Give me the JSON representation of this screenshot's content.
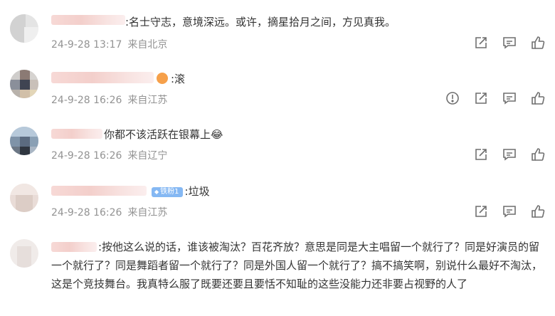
{
  "comments": [
    {
      "text": ":名士守志，意境深远。或许，摘星拾月之间，方见真我。",
      "date": "24-9-28 13:17",
      "location": "来自北京",
      "actions": [
        "share-icon",
        "comment-icon",
        "like-icon"
      ]
    },
    {
      "text": ":滚",
      "date": "24-9-28 16:26",
      "location": "来自江苏",
      "actions": [
        "report-icon",
        "share-icon",
        "comment-icon",
        "like-icon"
      ]
    },
    {
      "text": "你都不该活跃在银幕上",
      "emoji": "😂",
      "date": "24-9-28 16:26",
      "location": "来自辽宁",
      "actions": [
        "share-icon",
        "comment-icon",
        "like-icon"
      ]
    },
    {
      "badge": "铁粉1",
      "text": ":垃圾",
      "date": "24-9-28 16:26",
      "location": "来自江苏",
      "actions": [
        "share-icon",
        "comment-icon",
        "like-icon"
      ]
    },
    {
      "text": ":按他这么说的话，谁该被淘汰？百花齐放？意思是同是大主唱留一个就行了？同是好演员的留一个就行了？同是舞蹈者留一个就行了？同是外国人留一个就行了？搞不搞笑啊，别说什么最好不淘汰，这是个竞技舞台。我真特么服了既要还要且要恬不知耻的这些没能力还非要占视野的人了"
    }
  ],
  "colors": {
    "text": "#333333",
    "meta": "#939393",
    "icon": "#6f6f6f",
    "badge": "#85b8f3"
  }
}
